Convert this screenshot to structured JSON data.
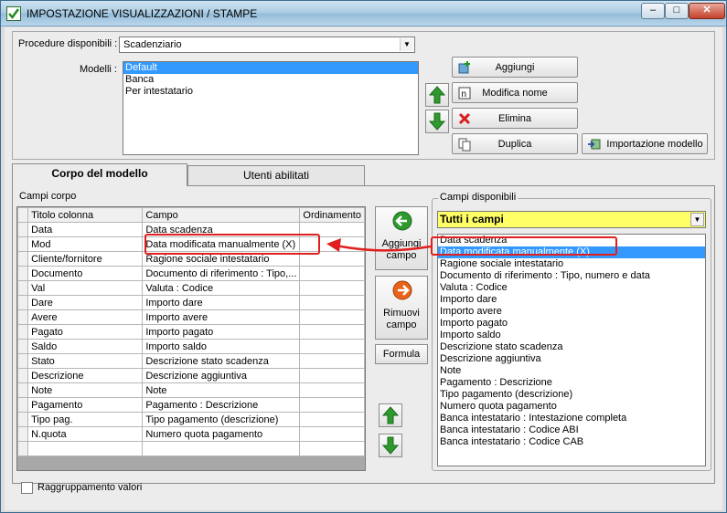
{
  "window": {
    "title": "IMPOSTAZIONE VISUALIZZAZIONI / STAMPE",
    "min": "–",
    "max": "□",
    "close": "✕"
  },
  "top": {
    "procedure_label": "Procedure disponibili :",
    "procedure_value": "Scadenziario",
    "modelli_label": "Modelli :",
    "modelli": [
      "Default",
      "Banca",
      "Per intestatario"
    ],
    "buttons": {
      "aggiungi": "Aggiungi",
      "modifica": "Modifica nome",
      "elimina": "Elimina",
      "duplica": "Duplica",
      "importazione": "Importazione modello"
    }
  },
  "tabs": [
    "Corpo del modello",
    "Utenti abilitati"
  ],
  "corpo": {
    "label": "Campi corpo",
    "headers": [
      "Titolo colonna",
      "Campo",
      "Ordinamento"
    ],
    "rows": [
      [
        "Data",
        "Data scadenza",
        ""
      ],
      [
        "Mod",
        "Data modificata manualmente (X)",
        ""
      ],
      [
        "Cliente/fornitore",
        "Ragione sociale intestatario",
        ""
      ],
      [
        "Documento",
        "Documento di riferimento : Tipo,...",
        ""
      ],
      [
        "Val",
        "Valuta : Codice",
        ""
      ],
      [
        "Dare",
        "Importo dare",
        ""
      ],
      [
        "Avere",
        "Importo avere",
        ""
      ],
      [
        "Pagato",
        "Importo pagato",
        ""
      ],
      [
        "Saldo",
        "Importo saldo",
        ""
      ],
      [
        "Stato",
        "Descrizione stato scadenza",
        ""
      ],
      [
        "Descrizione",
        "Descrizione aggiuntiva",
        ""
      ],
      [
        "Note",
        "Note",
        ""
      ],
      [
        "Pagamento",
        "Pagamento : Descrizione",
        ""
      ],
      [
        "Tipo pag.",
        "Tipo pagamento (descrizione)",
        ""
      ],
      [
        "N.quota",
        "Numero quota pagamento",
        ""
      ],
      [
        "",
        "",
        ""
      ]
    ]
  },
  "middle": {
    "aggiungi_l1": "Aggiungi",
    "aggiungi_l2": "campo",
    "rimuovi_l1": "Rimuovi",
    "rimuovi_l2": "campo",
    "formula": "Formula"
  },
  "disponibili": {
    "label": "Campi disponibili",
    "filter": "Tutti i campi",
    "items": [
      "Data scadenza",
      "Data modificata manualmente (X)",
      "Ragione sociale intestatario",
      "Documento di riferimento : Tipo, numero e data",
      "Valuta : Codice",
      "Importo dare",
      "Importo avere",
      "Importo pagato",
      "Importo saldo",
      "Descrizione stato scadenza",
      "Descrizione aggiuntiva",
      "Note",
      "Pagamento : Descrizione",
      "Tipo pagamento (descrizione)",
      "Numero quota pagamento",
      "Banca intestatario : Intestazione completa",
      "Banca intestatario : Codice ABI",
      "Banca intestatario : Codice CAB"
    ],
    "selected_index": 1
  },
  "footer": {
    "raggruppamento": "Raggruppamento valori"
  },
  "colors": {
    "selection": "#3399ff",
    "highlight": "#e02020",
    "filter_bg": "#ffff66",
    "arrow_green": "#2e9a2e",
    "arrow_orange": "#e8641a"
  }
}
